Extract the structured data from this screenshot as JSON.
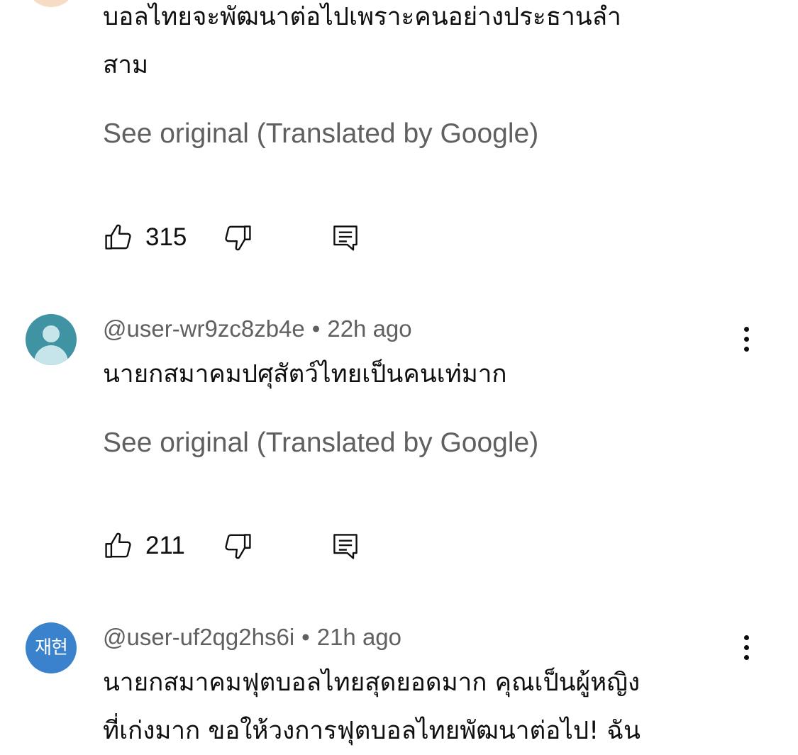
{
  "comments": [
    {
      "text_lines": [
        "บอลไทยจะพัฒนาต่อไปเพราะคนอย่างประธานลำ",
        "สาม"
      ],
      "see_original": "See original (Translated by Google)",
      "likes": "315"
    },
    {
      "author": "@user-wr9zc8zb4e",
      "separator": "•",
      "time": "22h ago",
      "text_lines": [
        "นายกสมาคมปศุสัตว์ไทยเป็นคนเท่มาก"
      ],
      "see_original": "See original (Translated by Google)",
      "likes": "211"
    },
    {
      "author": "@user-uf2qg2hs6i",
      "separator": "•",
      "time": "21h ago",
      "avatar_text": "재현",
      "text_lines": [
        "นายกสมาคมฟุตบอลไทยสุดยอดมาก คุณเป็นผู้หญิง",
        "ที่เก่งมาก ขอให้วงการฟุตบอลไทยพัฒนาต่อไป! ฉัน"
      ]
    }
  ],
  "icons": {
    "like": "thumbs-up-icon",
    "dislike": "thumbs-down-icon",
    "reply": "reply-comment-icon",
    "more": "more-vertical-icon"
  },
  "colors": {
    "text_primary": "#0f0f0f",
    "text_secondary": "#606060",
    "avatar_default": "#3f93a3",
    "avatar_letter": "#3b82cc"
  }
}
